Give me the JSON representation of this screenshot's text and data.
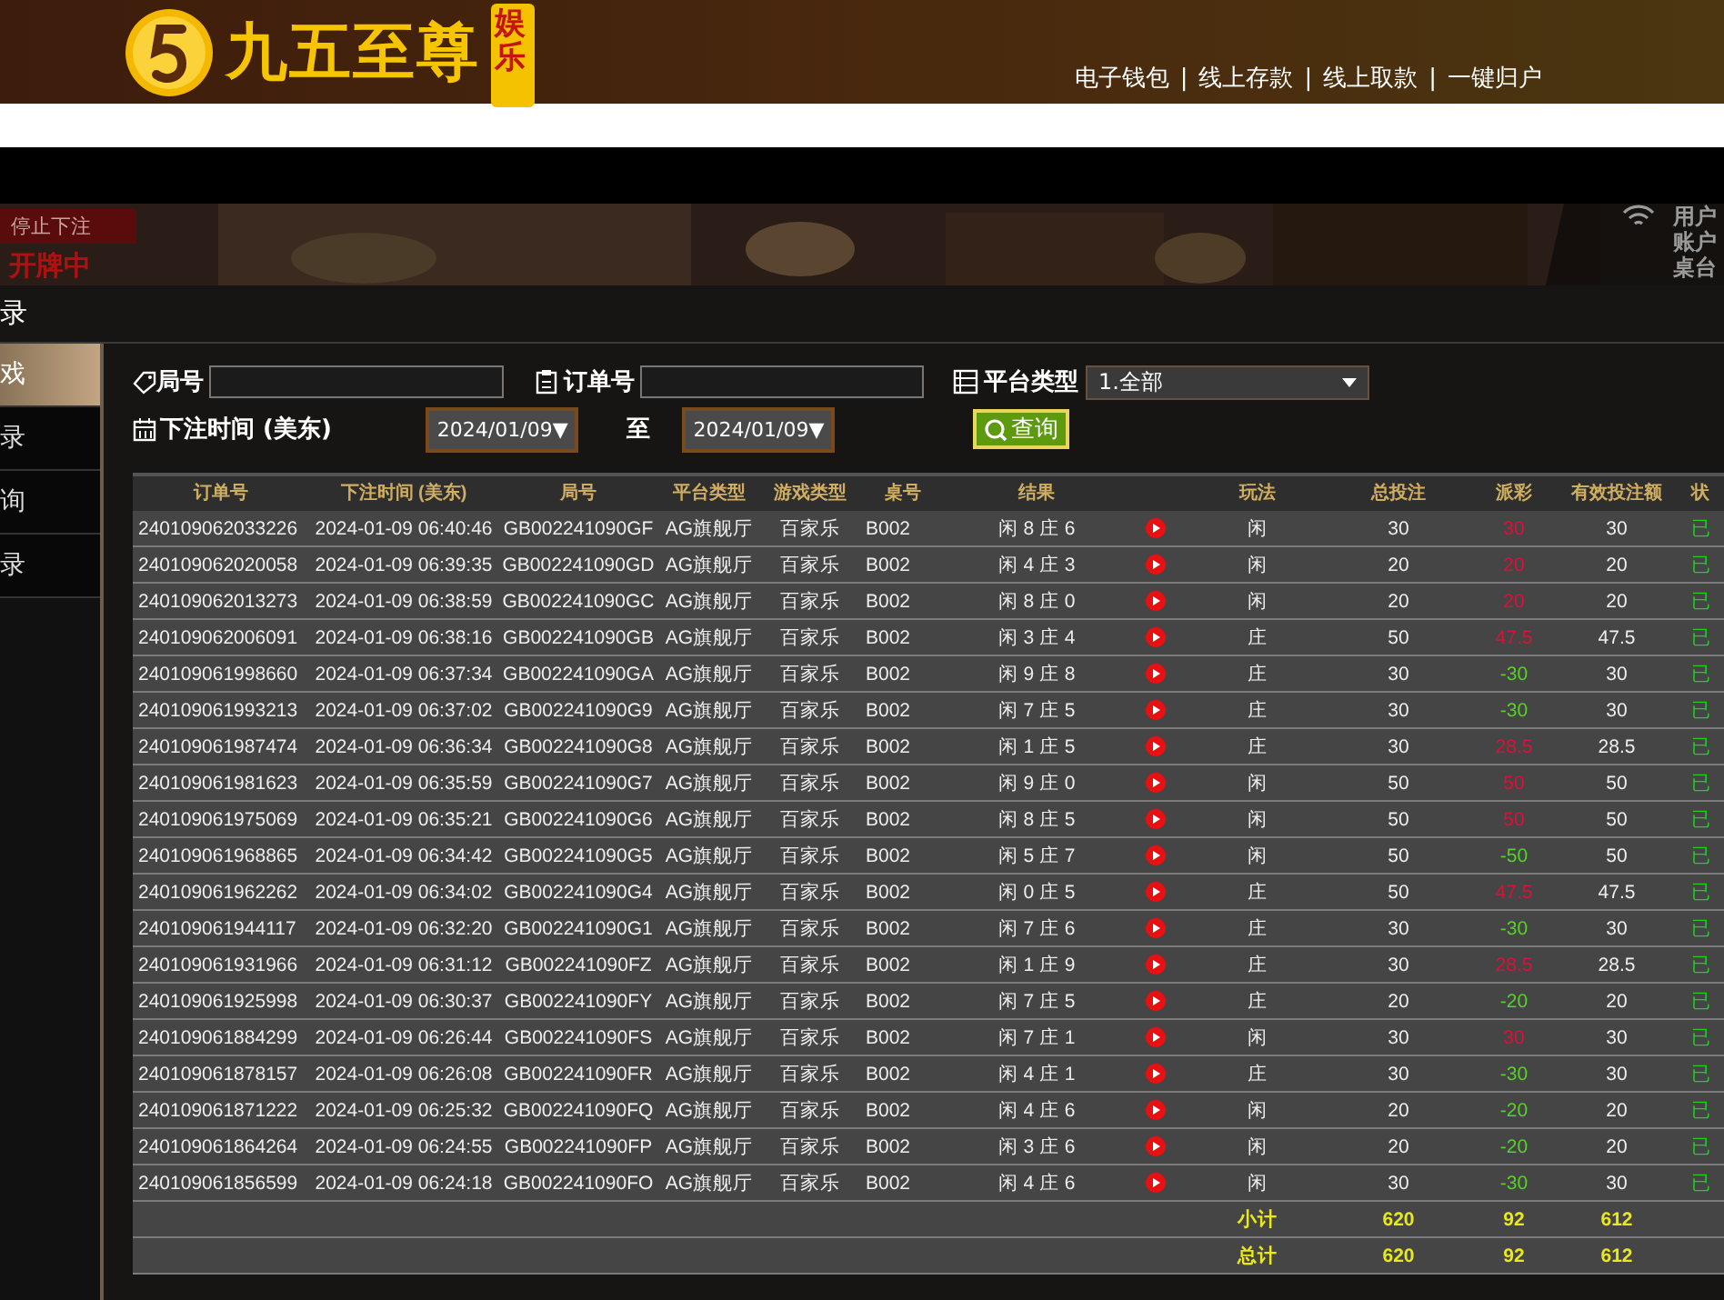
{
  "header": {
    "logo_text": "九五至尊",
    "logo_badge": "娱乐",
    "links": [
      "电子钱包",
      "线上存款",
      "线上取款",
      "一键归户"
    ],
    "separator": "|"
  },
  "video": {
    "status": "停止下注",
    "phase": "开牌中",
    "info": [
      "用户",
      "账户",
      "桌台"
    ]
  },
  "modal": {
    "title": "录"
  },
  "sidebar": {
    "items": [
      {
        "label": "戏",
        "selected": true
      },
      {
        "label": "录",
        "selected": false
      },
      {
        "label": "询",
        "selected": false
      },
      {
        "label": "录",
        "selected": false
      }
    ]
  },
  "filters": {
    "round_label": "局号",
    "order_label": "订单号",
    "platform_label": "平台类型",
    "platform_value": "1.全部",
    "time_label": "下注时间 (美东)",
    "date_from": "2024/01/09▼",
    "to_label": "至",
    "date_to": "2024/01/09▼",
    "query_button": "查询"
  },
  "table": {
    "columns": [
      "订单号",
      "下注时间 (美东)",
      "局号",
      "平台类型",
      "游戏类型",
      "桌号",
      "结果",
      "",
      "玩法",
      "总投注",
      "派彩",
      "有效投注额",
      "状"
    ],
    "rows": [
      {
        "order": "240109062033226",
        "time": "2024-01-09 06:40:46",
        "round": "GB002241090GF",
        "platform": "AG旗舰厅",
        "game": "百家乐",
        "table": "B002",
        "result": "闲 8 庄 6",
        "play": "闲",
        "bet": "30",
        "payout": "30",
        "color": "#d81238",
        "valid": "30",
        "status": "已"
      },
      {
        "order": "240109062020058",
        "time": "2024-01-09 06:39:35",
        "round": "GB002241090GD",
        "platform": "AG旗舰厅",
        "game": "百家乐",
        "table": "B002",
        "result": "闲 4 庄 3",
        "play": "闲",
        "bet": "20",
        "payout": "20",
        "color": "#d81238",
        "valid": "20",
        "status": "已"
      },
      {
        "order": "240109062013273",
        "time": "2024-01-09 06:38:59",
        "round": "GB002241090GC",
        "platform": "AG旗舰厅",
        "game": "百家乐",
        "table": "B002",
        "result": "闲 8 庄 0",
        "play": "闲",
        "bet": "20",
        "payout": "20",
        "color": "#d81238",
        "valid": "20",
        "status": "已"
      },
      {
        "order": "240109062006091",
        "time": "2024-01-09 06:38:16",
        "round": "GB002241090GB",
        "platform": "AG旗舰厅",
        "game": "百家乐",
        "table": "B002",
        "result": "闲 3 庄 4",
        "play": "庄",
        "bet": "50",
        "payout": "47.5",
        "color": "#d81238",
        "valid": "47.5",
        "status": "已"
      },
      {
        "order": "240109061998660",
        "time": "2024-01-09 06:37:34",
        "round": "GB002241090GA",
        "platform": "AG旗舰厅",
        "game": "百家乐",
        "table": "B002",
        "result": "闲 9 庄 8",
        "play": "庄",
        "bet": "30",
        "payout": "-30",
        "color": "#56d12a",
        "valid": "30",
        "status": "已"
      },
      {
        "order": "240109061993213",
        "time": "2024-01-09 06:37:02",
        "round": "GB002241090G9",
        "platform": "AG旗舰厅",
        "game": "百家乐",
        "table": "B002",
        "result": "闲 7 庄 5",
        "play": "庄",
        "bet": "30",
        "payout": "-30",
        "color": "#56d12a",
        "valid": "30",
        "status": "已"
      },
      {
        "order": "240109061987474",
        "time": "2024-01-09 06:36:34",
        "round": "GB002241090G8",
        "platform": "AG旗舰厅",
        "game": "百家乐",
        "table": "B002",
        "result": "闲 1 庄 5",
        "play": "庄",
        "bet": "30",
        "payout": "28.5",
        "color": "#d81238",
        "valid": "28.5",
        "status": "已"
      },
      {
        "order": "240109061981623",
        "time": "2024-01-09 06:35:59",
        "round": "GB002241090G7",
        "platform": "AG旗舰厅",
        "game": "百家乐",
        "table": "B002",
        "result": "闲 9 庄 0",
        "play": "闲",
        "bet": "50",
        "payout": "50",
        "color": "#d81238",
        "valid": "50",
        "status": "已"
      },
      {
        "order": "240109061975069",
        "time": "2024-01-09 06:35:21",
        "round": "GB002241090G6",
        "platform": "AG旗舰厅",
        "game": "百家乐",
        "table": "B002",
        "result": "闲 8 庄 5",
        "play": "闲",
        "bet": "50",
        "payout": "50",
        "color": "#d81238",
        "valid": "50",
        "status": "已"
      },
      {
        "order": "240109061968865",
        "time": "2024-01-09 06:34:42",
        "round": "GB002241090G5",
        "platform": "AG旗舰厅",
        "game": "百家乐",
        "table": "B002",
        "result": "闲 5 庄 7",
        "play": "闲",
        "bet": "50",
        "payout": "-50",
        "color": "#56d12a",
        "valid": "50",
        "status": "已"
      },
      {
        "order": "240109061962262",
        "time": "2024-01-09 06:34:02",
        "round": "GB002241090G4",
        "platform": "AG旗舰厅",
        "game": "百家乐",
        "table": "B002",
        "result": "闲 0 庄 5",
        "play": "庄",
        "bet": "50",
        "payout": "47.5",
        "color": "#d81238",
        "valid": "47.5",
        "status": "已"
      },
      {
        "order": "240109061944117",
        "time": "2024-01-09 06:32:20",
        "round": "GB002241090G1",
        "platform": "AG旗舰厅",
        "game": "百家乐",
        "table": "B002",
        "result": "闲 7 庄 6",
        "play": "庄",
        "bet": "30",
        "payout": "-30",
        "color": "#56d12a",
        "valid": "30",
        "status": "已"
      },
      {
        "order": "240109061931966",
        "time": "2024-01-09 06:31:12",
        "round": "GB002241090FZ",
        "platform": "AG旗舰厅",
        "game": "百家乐",
        "table": "B002",
        "result": "闲 1 庄 9",
        "play": "庄",
        "bet": "30",
        "payout": "28.5",
        "color": "#d81238",
        "valid": "28.5",
        "status": "已"
      },
      {
        "order": "240109061925998",
        "time": "2024-01-09 06:30:37",
        "round": "GB002241090FY",
        "platform": "AG旗舰厅",
        "game": "百家乐",
        "table": "B002",
        "result": "闲 7 庄 5",
        "play": "庄",
        "bet": "20",
        "payout": "-20",
        "color": "#56d12a",
        "valid": "20",
        "status": "已"
      },
      {
        "order": "240109061884299",
        "time": "2024-01-09 06:26:44",
        "round": "GB002241090FS",
        "platform": "AG旗舰厅",
        "game": "百家乐",
        "table": "B002",
        "result": "闲 7 庄 1",
        "play": "闲",
        "bet": "30",
        "payout": "30",
        "color": "#d81238",
        "valid": "30",
        "status": "已"
      },
      {
        "order": "240109061878157",
        "time": "2024-01-09 06:26:08",
        "round": "GB002241090FR",
        "platform": "AG旗舰厅",
        "game": "百家乐",
        "table": "B002",
        "result": "闲 4 庄 1",
        "play": "庄",
        "bet": "30",
        "payout": "-30",
        "color": "#56d12a",
        "valid": "30",
        "status": "已"
      },
      {
        "order": "240109061871222",
        "time": "2024-01-09 06:25:32",
        "round": "GB002241090FQ",
        "platform": "AG旗舰厅",
        "game": "百家乐",
        "table": "B002",
        "result": "闲 4 庄 6",
        "play": "闲",
        "bet": "20",
        "payout": "-20",
        "color": "#56d12a",
        "valid": "20",
        "status": "已"
      },
      {
        "order": "240109061864264",
        "time": "2024-01-09 06:24:55",
        "round": "GB002241090FP",
        "platform": "AG旗舰厅",
        "game": "百家乐",
        "table": "B002",
        "result": "闲 3 庄 6",
        "play": "闲",
        "bet": "20",
        "payout": "-20",
        "color": "#56d12a",
        "valid": "20",
        "status": "已"
      },
      {
        "order": "240109061856599",
        "time": "2024-01-09 06:24:18",
        "round": "GB002241090FO",
        "platform": "AG旗舰厅",
        "game": "百家乐",
        "table": "B002",
        "result": "闲 4 庄 6",
        "play": "闲",
        "bet": "30",
        "payout": "-30",
        "color": "#56d12a",
        "valid": "30",
        "status": "已"
      }
    ],
    "totals": [
      {
        "label": "小计",
        "bet": "620",
        "payout": "92",
        "valid": "612"
      },
      {
        "label": "总计",
        "bet": "620",
        "payout": "92",
        "valid": "612"
      }
    ]
  }
}
